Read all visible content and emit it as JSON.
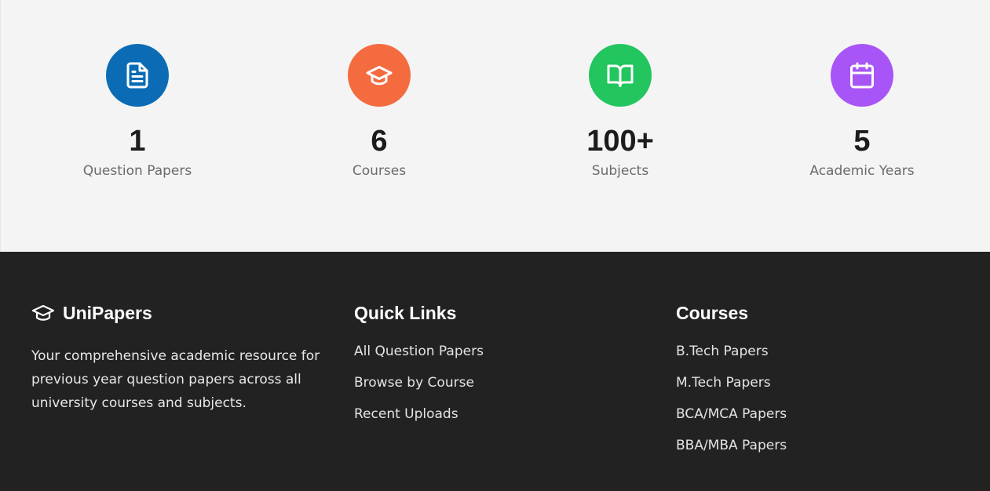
{
  "stats": [
    {
      "icon": "document-icon",
      "color": "#0b6cb5",
      "value": "1",
      "label": "Question Papers"
    },
    {
      "icon": "graduation-cap-icon",
      "color": "#f46b3f",
      "value": "6",
      "label": "Courses"
    },
    {
      "icon": "book-open-icon",
      "color": "#22c55e",
      "value": "100+",
      "label": "Subjects"
    },
    {
      "icon": "calendar-icon",
      "color": "#a855f7",
      "value": "5",
      "label": "Academic Years"
    }
  ],
  "footer": {
    "brand": {
      "icon": "graduation-cap-icon",
      "name": "UniPapers",
      "description": "Your comprehensive academic resource for previous year question papers across all university courses and subjects."
    },
    "quick_links": {
      "title": "Quick Links",
      "items": [
        "All Question Papers",
        "Browse by Course",
        "Recent Uploads"
      ]
    },
    "courses": {
      "title": "Courses",
      "items": [
        "B.Tech Papers",
        "M.Tech Papers",
        "BCA/MCA Papers",
        "BBA/MBA Papers"
      ]
    }
  }
}
